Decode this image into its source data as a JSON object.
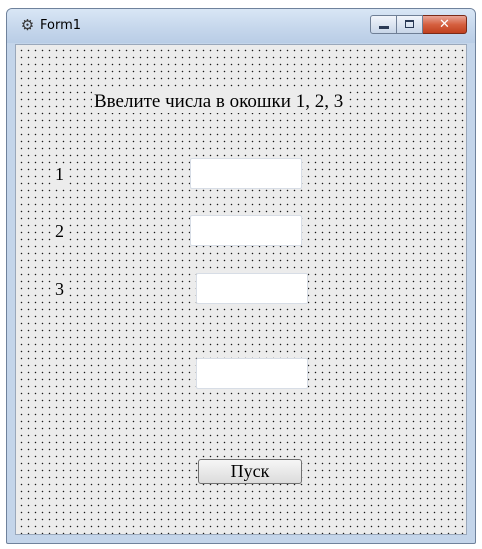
{
  "window": {
    "title": "Form1",
    "icon": "gear-cluster-icon",
    "buttons": {
      "minimize_icon": "minimize-icon",
      "maximize_icon": "maximize-icon",
      "close_icon": "close-icon",
      "close_glyph": "✕"
    }
  },
  "form": {
    "heading": "Ввелите числа в окошки 1, 2, 3",
    "fields": [
      {
        "label": "1",
        "value": ""
      },
      {
        "label": "2",
        "value": ""
      },
      {
        "label": "3",
        "value": ""
      }
    ],
    "result_value": "",
    "start_button": "Пуск"
  },
  "colors": {
    "titlebar": "#c6d7ec",
    "close_button": "#c9482a",
    "client_background": "#ececec",
    "grid_dots": "#1a1a1a"
  }
}
